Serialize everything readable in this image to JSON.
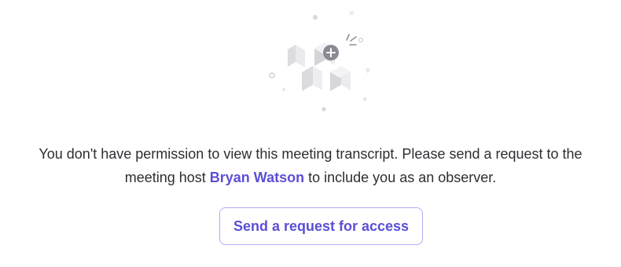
{
  "illustration": {
    "icon": "restricted-content-cubes-illustration",
    "badge_icon": "plus-icon"
  },
  "message": {
    "before": "You don't have permission to view this meeting transcript. Please send a request to the meeting host ",
    "host_name": "Bryan Watson",
    "after": " to include you as an observer."
  },
  "actions": {
    "request_access_label": "Send a request for access"
  },
  "colors": {
    "accent": "#5b4fd6",
    "button_border": "#b4aaf0",
    "text": "#2e2e33"
  }
}
